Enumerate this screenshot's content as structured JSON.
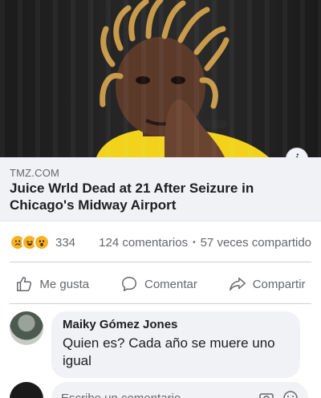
{
  "link_preview": {
    "domain": "TMZ.COM",
    "headline": "Juice Wrld Dead at 21 After Seizure in Chicago's Midway Airport",
    "info_label": "i"
  },
  "stats": {
    "reactions": [
      "sad-emoji-icon",
      "haha-emoji-icon",
      "wow-emoji-icon"
    ],
    "reaction_count": "334",
    "comments": "124 comentarios",
    "separator": "•",
    "shares": "57 veces compartido"
  },
  "actions": {
    "like": "Me gusta",
    "comment": "Comentar",
    "share": "Compartir"
  },
  "comment": {
    "author": "Maiky Gómez Jones",
    "text": "Quien es? Cada año se muere uno igual"
  },
  "composer": {
    "placeholder": "Escribe un comentario..."
  },
  "colors": {
    "link_box_bg": "#f0f2f5",
    "text_secondary": "#65676b",
    "reaction_yellow": "#f7b125"
  }
}
